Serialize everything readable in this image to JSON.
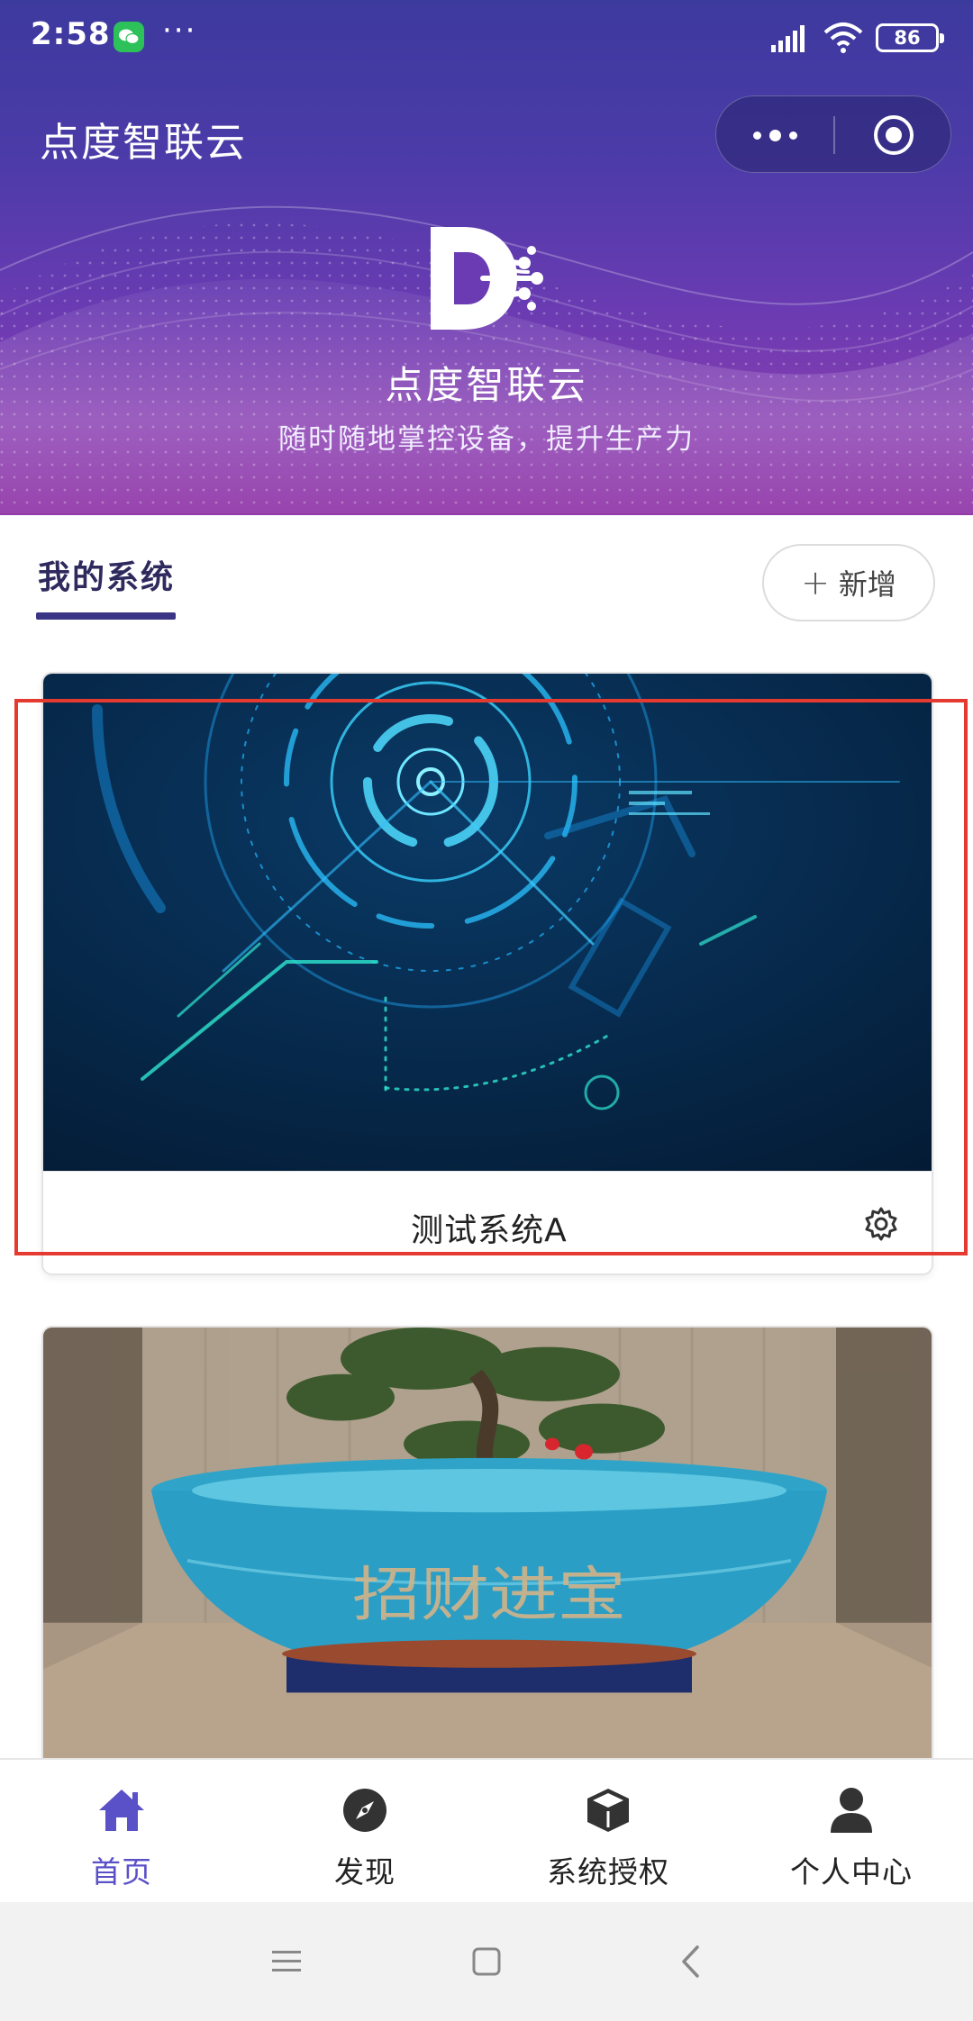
{
  "status_bar": {
    "time": "2:58",
    "more_dots": "···",
    "battery": "86"
  },
  "header": {
    "app_title": "点度智联云",
    "brand_name": "点度智联云",
    "tagline": "随时随地掌控设备，提升生产力"
  },
  "section": {
    "title": "我的系统",
    "add_label": "新增",
    "add_icon": "plus-icon"
  },
  "systems": [
    {
      "name": "测试系统A",
      "image": "tech-hud-illustration",
      "settings_icon": "gear-icon"
    },
    {
      "name": "",
      "image": "bonsai-photo",
      "pot_text": "招财进宝"
    }
  ],
  "tabs": [
    {
      "label": "首页",
      "icon": "home-icon",
      "active": true
    },
    {
      "label": "发现",
      "icon": "compass-icon",
      "active": false
    },
    {
      "label": "系统授权",
      "icon": "cube-icon",
      "active": false
    },
    {
      "label": "个人中心",
      "icon": "user-icon",
      "active": false
    }
  ],
  "colors": {
    "header_top": "#3d3a9e",
    "header_bottom": "#933aa9",
    "accent": "#5a50c8",
    "highlight": "#e53a2f",
    "section_title": "#2f2a5e"
  }
}
